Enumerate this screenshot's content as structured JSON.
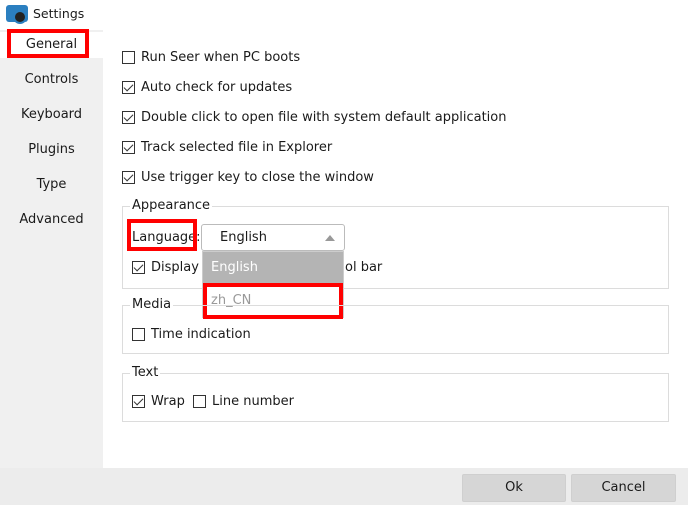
{
  "window": {
    "title": "Settings"
  },
  "sidebar": {
    "items": [
      {
        "label": "General"
      },
      {
        "label": "Controls"
      },
      {
        "label": "Keyboard"
      },
      {
        "label": "Plugins"
      },
      {
        "label": "Type"
      },
      {
        "label": "Advanced"
      }
    ]
  },
  "general": {
    "options": [
      {
        "label": "Run Seer when PC boots",
        "checked": false
      },
      {
        "label": "Auto check for updates",
        "checked": true
      },
      {
        "label": "Double click to open file with system default application",
        "checked": true
      },
      {
        "label": "Track selected file in Explorer",
        "checked": true
      },
      {
        "label": "Use trigger key to close the window",
        "checked": true
      }
    ],
    "appearance": {
      "title": "Appearance",
      "language_label": "Language:",
      "language_value": "English",
      "language_options": [
        "English",
        "zh_CN"
      ],
      "display_prefix": "Display t",
      "display_suffix": "ol bar"
    },
    "media": {
      "title": "Media",
      "time_indication": "Time indication"
    },
    "text": {
      "title": "Text",
      "wrap": "Wrap",
      "line_number": "Line number"
    }
  },
  "footer": {
    "ok": "Ok",
    "cancel": "Cancel"
  },
  "colors": {
    "highlight": "#ff0000",
    "dropdown_selected": "#b4b4b4"
  }
}
